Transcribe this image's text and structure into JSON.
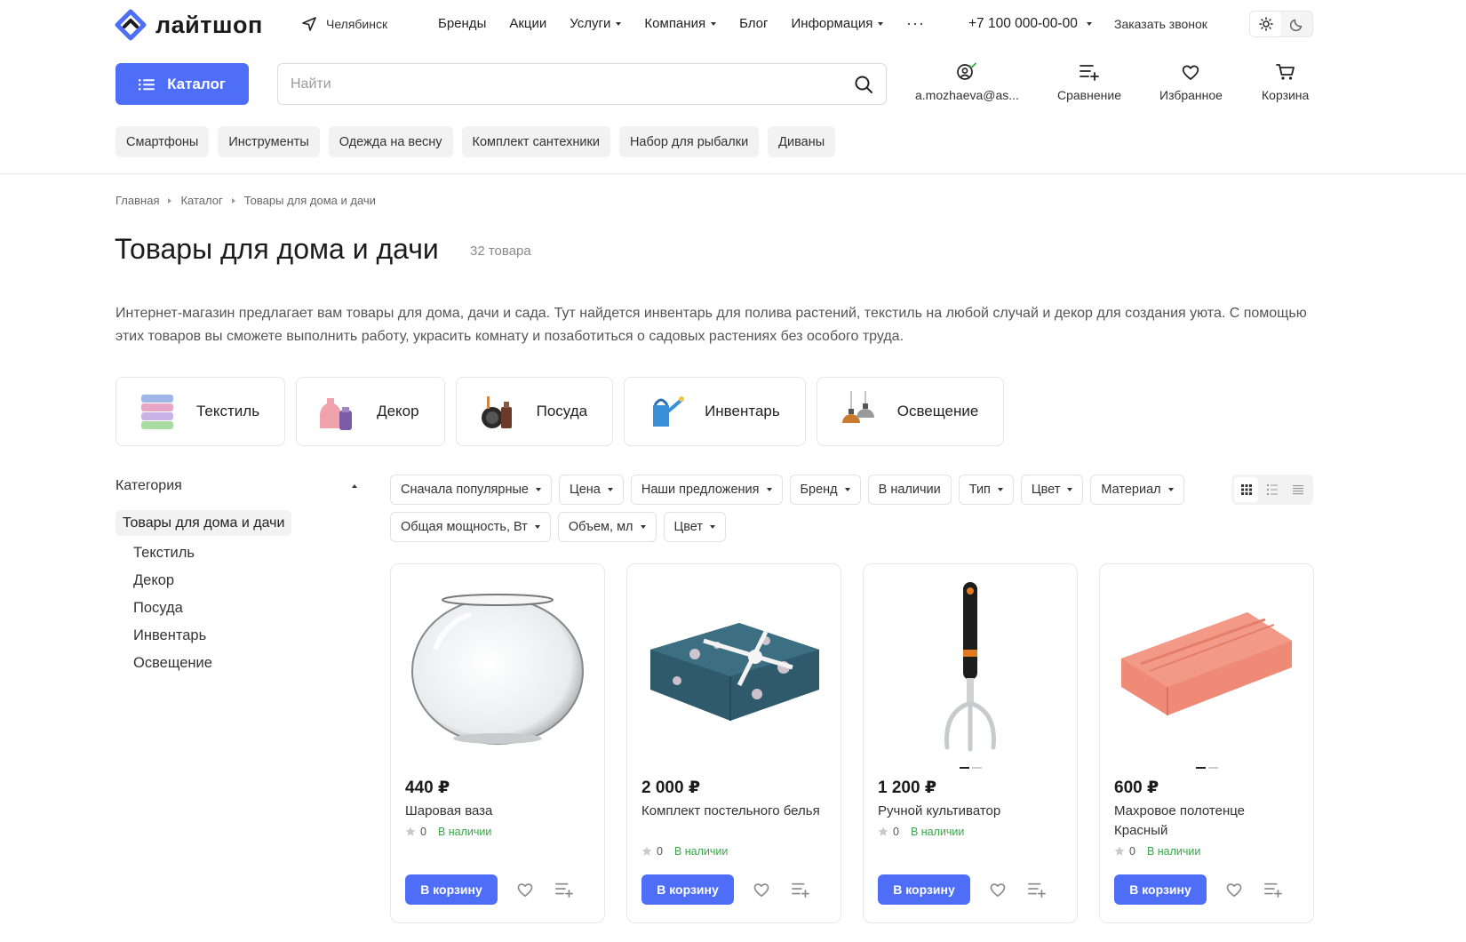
{
  "brand": {
    "name": "лайтшоп"
  },
  "header": {
    "city": "Челябинск",
    "nav": [
      {
        "label": "Бренды",
        "dropdown": false
      },
      {
        "label": "Акции",
        "dropdown": false
      },
      {
        "label": "Услуги",
        "dropdown": true
      },
      {
        "label": "Компания",
        "dropdown": true
      },
      {
        "label": "Блог",
        "dropdown": false
      },
      {
        "label": "Информация",
        "dropdown": true
      }
    ],
    "more": "···",
    "phone": "+7 100 000-00-00",
    "callback": "Заказать звонок"
  },
  "toolbar": {
    "catalog_label": "Каталог",
    "search_placeholder": "Найти",
    "account_label": "a.mozhaeva@as...",
    "compare_label": "Сравнение",
    "favorites_label": "Избранное",
    "cart_label": "Корзина"
  },
  "quick_chips": [
    "Смартфоны",
    "Инструменты",
    "Одежда на весну",
    "Комплект сантехники",
    "Набор для рыбалки",
    "Диваны"
  ],
  "breadcrumb": [
    "Главная",
    "Каталог",
    "Товары для дома и дачи"
  ],
  "page": {
    "title": "Товары для дома и дачи",
    "count": "32 товара",
    "description": "Интернет-магазин предлагает вам товары для дома, дачи и сада. Тут найдется инвентарь для полива растений, текстиль на любой случай и декор для создания уюта. С помощью этих товаров вы сможете выполнить работу, украсить комнату и позаботиться о садовых растениях без особого труда."
  },
  "categories": [
    "Текстиль",
    "Декор",
    "Посуда",
    "Инвентарь",
    "Освещение"
  ],
  "sidebar": {
    "heading": "Категория",
    "active": "Товары для дома и дачи",
    "items": [
      "Текстиль",
      "Декор",
      "Посуда",
      "Инвентарь",
      "Освещение"
    ]
  },
  "filters_row1": [
    {
      "label": "Сначала популярные",
      "dropdown": true
    },
    {
      "label": "Цена",
      "dropdown": true
    },
    {
      "label": "Наши предложения",
      "dropdown": true
    },
    {
      "label": "Бренд",
      "dropdown": true
    },
    {
      "label": "В наличии",
      "dropdown": false
    },
    {
      "label": "Тип",
      "dropdown": true
    },
    {
      "label": "Цвет",
      "dropdown": true
    },
    {
      "label": "Материал",
      "dropdown": true
    }
  ],
  "filters_row2": [
    {
      "label": "Общая мощность, Вт",
      "dropdown": true
    },
    {
      "label": "Объем, мл",
      "dropdown": true
    },
    {
      "label": "Цвет",
      "dropdown": true
    }
  ],
  "products": [
    {
      "price": "440 ₽",
      "name": "Шаровая ваза",
      "rating": "0",
      "stock": "В наличии",
      "buy": "В корзину",
      "image": "glass-vase"
    },
    {
      "price": "2 000 ₽",
      "name": "Комплект постельного белья",
      "rating": "0",
      "stock": "В наличии",
      "buy": "В корзину",
      "image": "bedding-set"
    },
    {
      "price": "1 200 ₽",
      "name": "Ручной культиватор",
      "rating": "0",
      "stock": "В наличии",
      "buy": "В корзину",
      "image": "hand-cultivator"
    },
    {
      "price": "600 ₽",
      "name": "Махровое полотенце Красный",
      "rating": "0",
      "stock": "В наличии",
      "buy": "В корзину",
      "image": "terry-towel"
    }
  ],
  "colors": {
    "accent": "#4f6ef7",
    "stock": "#3aa64a"
  }
}
